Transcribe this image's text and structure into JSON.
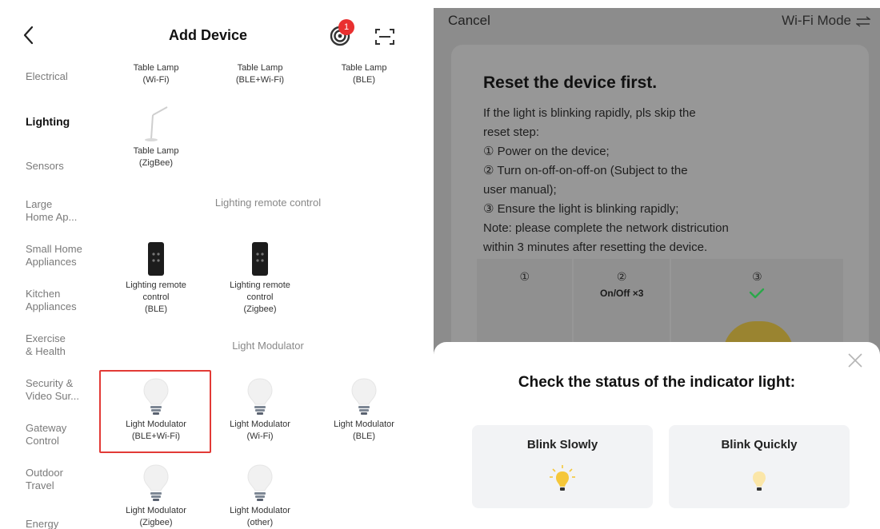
{
  "left": {
    "title": "Add Device",
    "notification_count": "1",
    "categories": [
      {
        "label": "Electrical"
      },
      {
        "label": "Lighting",
        "active": true
      },
      {
        "label": "Sensors"
      },
      {
        "label": "Large\nHome Ap..."
      },
      {
        "label": "Small Home\nAppliances"
      },
      {
        "label": "Kitchen\nAppliances"
      },
      {
        "label": "Exercise\n& Health"
      },
      {
        "label": "Security &\nVideo Sur..."
      },
      {
        "label": "Gateway\nControl"
      },
      {
        "label": "Outdoor\nTravel"
      },
      {
        "label": "Energy"
      }
    ],
    "table_lamps": [
      {
        "label": "Table Lamp\n(Wi-Fi)"
      },
      {
        "label": "Table Lamp\n(BLE+Wi-Fi)"
      },
      {
        "label": "Table Lamp\n(BLE)"
      },
      {
        "label": "Table Lamp\n(ZigBee)"
      }
    ],
    "remote_section": "Lighting remote control",
    "remotes": [
      {
        "label": "Lighting remote\ncontrol\n(BLE)"
      },
      {
        "label": "Lighting remote\ncontrol\n(Zigbee)"
      }
    ],
    "modulator_section": "Light Modulator",
    "modulators": [
      {
        "label": "Light Modulator\n(BLE+Wi-Fi)"
      },
      {
        "label": "Light Modulator\n(Wi-Fi)"
      },
      {
        "label": "Light Modulator\n(BLE)"
      },
      {
        "label": "Light Modulator\n(Zigbee)"
      },
      {
        "label": "Light Modulator\n(other)"
      }
    ]
  },
  "right": {
    "cancel_label": "Cancel",
    "mode_label": "Wi-Fi Mode",
    "card_title": "Reset the device first.",
    "instructions": [
      "If the light is blinking rapidly, pls skip the\nreset step:",
      "① Power on the device;",
      "② Turn on-off-on-off-on (Subject to the\nuser manual);",
      "③ Ensure the light is blinking rapidly;",
      "Note: please complete the network districution\nwithin 3 minutes after resetting the device."
    ],
    "steps": [
      {
        "num": "①",
        "sub": ""
      },
      {
        "num": "②",
        "sub": "On/Off ×3"
      },
      {
        "num": "③",
        "sub": ""
      }
    ],
    "sheet_title": "Check the status of the indicator light:",
    "options": [
      {
        "label": "Blink Slowly"
      },
      {
        "label": "Blink Quickly"
      }
    ]
  },
  "colors": {
    "highlight": "#e23a36",
    "badge": "#e93030",
    "check": "#2aa84a",
    "bulb_on": "#f5c73a"
  }
}
